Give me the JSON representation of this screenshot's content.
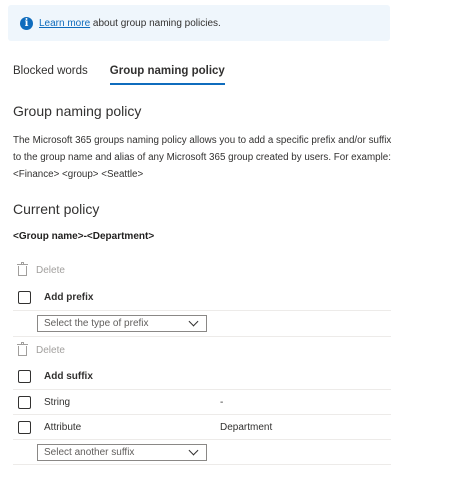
{
  "info": {
    "link_text": "Learn more",
    "text": " about group naming policies."
  },
  "tabs": [
    {
      "label": "Blocked words"
    },
    {
      "label": "Group naming policy"
    }
  ],
  "section": {
    "title": "Group naming policy",
    "description": "The Microsoft 365 groups naming policy allows you to add a specific prefix and/or suffix to the group name and alias of any Microsoft 365 group created by users. For example: <Finance> <group> <Seattle>"
  },
  "current_policy": {
    "title": "Current policy",
    "format": "<Group name>-<Department>"
  },
  "prefix": {
    "delete_label": "Delete",
    "add_label": "Add prefix",
    "dropdown_placeholder": "Select the type of prefix"
  },
  "suffix": {
    "delete_label": "Delete",
    "add_label": "Add suffix",
    "rows": [
      {
        "label": "String",
        "value": "-"
      },
      {
        "label": "Attribute",
        "value": "Department"
      }
    ],
    "dropdown_placeholder": "Select another suffix"
  }
}
